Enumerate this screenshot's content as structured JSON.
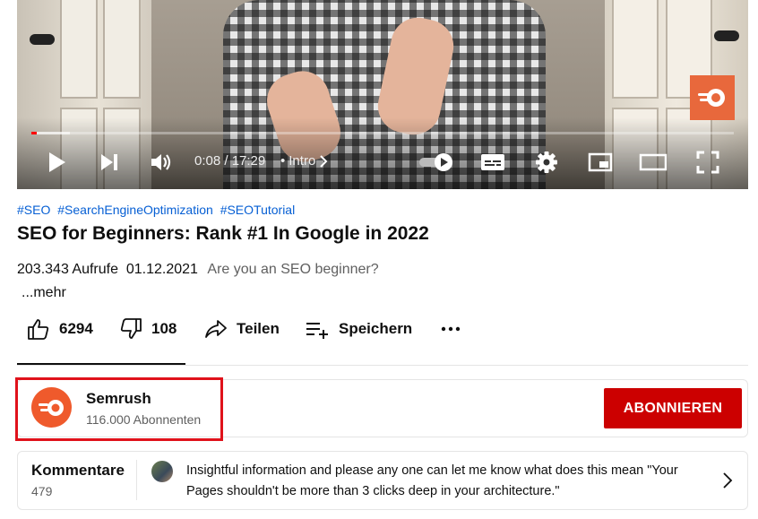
{
  "video": {
    "time": "0:08 / 17:29",
    "chapter_sep": "•",
    "chapter": "Intro",
    "progress": 0.008,
    "buffered": 0.055
  },
  "meta": {
    "hashtags": [
      "#SEO",
      "#SearchEngineOptimization",
      "#SEOTutorial"
    ],
    "title": "SEO for Beginners: Rank #1 In Google in 2022",
    "views": "203.343 Aufrufe",
    "date": "01.12.2021",
    "description_snippet": "Are you an SEO beginner?",
    "more": "...mehr"
  },
  "actions": {
    "likes": "6294",
    "dislikes": "108",
    "share": "Teilen",
    "save": "Speichern"
  },
  "channel": {
    "name": "Semrush",
    "subscribers": "116.000 Abonnenten",
    "subscribe": "ABONNIEREN"
  },
  "comments": {
    "title": "Kommentare",
    "count": "479",
    "top_comment": "Insightful information and please any one can let me know what does this mean \"Your Pages shouldn't be more than 3 clicks deep in your architecture.\""
  },
  "colors": {
    "accent_red": "#cc0000",
    "semrush_orange": "#ef5a2c",
    "hashtag_blue": "#065fd4",
    "highlight_red": "#e0121b"
  },
  "icons": [
    "play-icon",
    "next-icon",
    "volume-icon",
    "chevron-right-icon",
    "autoplay-toggle",
    "subtitles-icon",
    "settings-icon",
    "miniplayer-icon",
    "theater-icon",
    "fullscreen-icon",
    "like-icon",
    "dislike-icon",
    "share-icon",
    "save-icon",
    "more-icon",
    "semrush-logo"
  ]
}
